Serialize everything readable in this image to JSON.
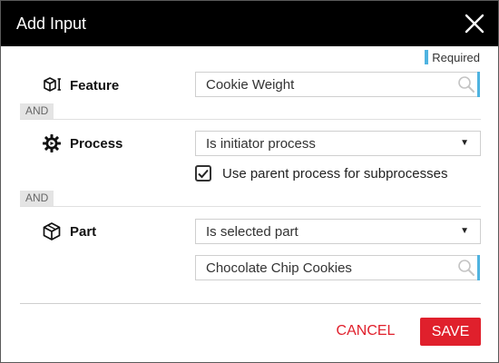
{
  "dialog": {
    "title": "Add Input",
    "close_icon": "close-icon",
    "required_label": "Required"
  },
  "rows": {
    "feature": {
      "label": "Feature",
      "icon": "feature-cube-icon",
      "search_value": "Cookie Weight"
    },
    "process": {
      "connector": "AND",
      "label": "Process",
      "icon": "process-gear-icon",
      "select_value": "Is initiator process",
      "checkbox_label": "Use parent process for subprocesses",
      "checkbox_checked": true
    },
    "part": {
      "connector": "AND",
      "label": "Part",
      "icon": "part-box-icon",
      "select_value": "Is selected part",
      "search_value": "Chocolate Chip Cookies"
    }
  },
  "footer": {
    "cancel_label": "CANCEL",
    "save_label": "SAVE"
  },
  "colors": {
    "titlebar": "#000000",
    "accent_red": "#e0202c",
    "required_marker": "#4fb3e0"
  }
}
